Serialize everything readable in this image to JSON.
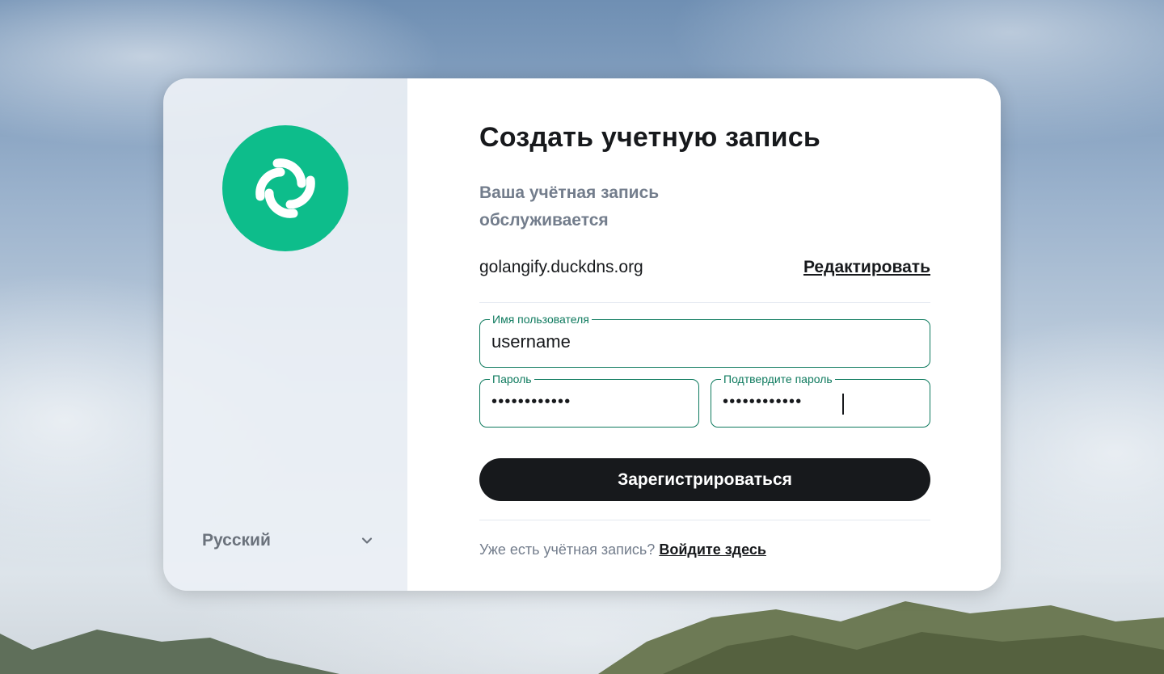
{
  "auth": {
    "title": "Создать учетную запись",
    "server_heading": "Ваша учётная запись обслуживается",
    "server_name": "golangify.duckdns.org",
    "edit_label": "Редактировать",
    "username": {
      "label": "Имя пользователя",
      "value": "username"
    },
    "password": {
      "label": "Пароль",
      "masked_value": "••••••••••••"
    },
    "confirm_password": {
      "label": "Подтвердите пароль",
      "masked_value": "••••••••••••"
    },
    "submit_label": "Зарегистрироваться",
    "footer_text": "Уже есть учётная запись?",
    "login_link": "Войдите здесь"
  },
  "sidebar": {
    "language": "Русский"
  },
  "icons": {
    "logo": "element-logo-icon",
    "info": "info-icon",
    "chevron": "chevron-down-icon"
  },
  "colors": {
    "brand": "#0dbd8b",
    "accent_border": "#0e7a5e",
    "primary_button": "#17191c",
    "muted_text": "#737d8c"
  }
}
